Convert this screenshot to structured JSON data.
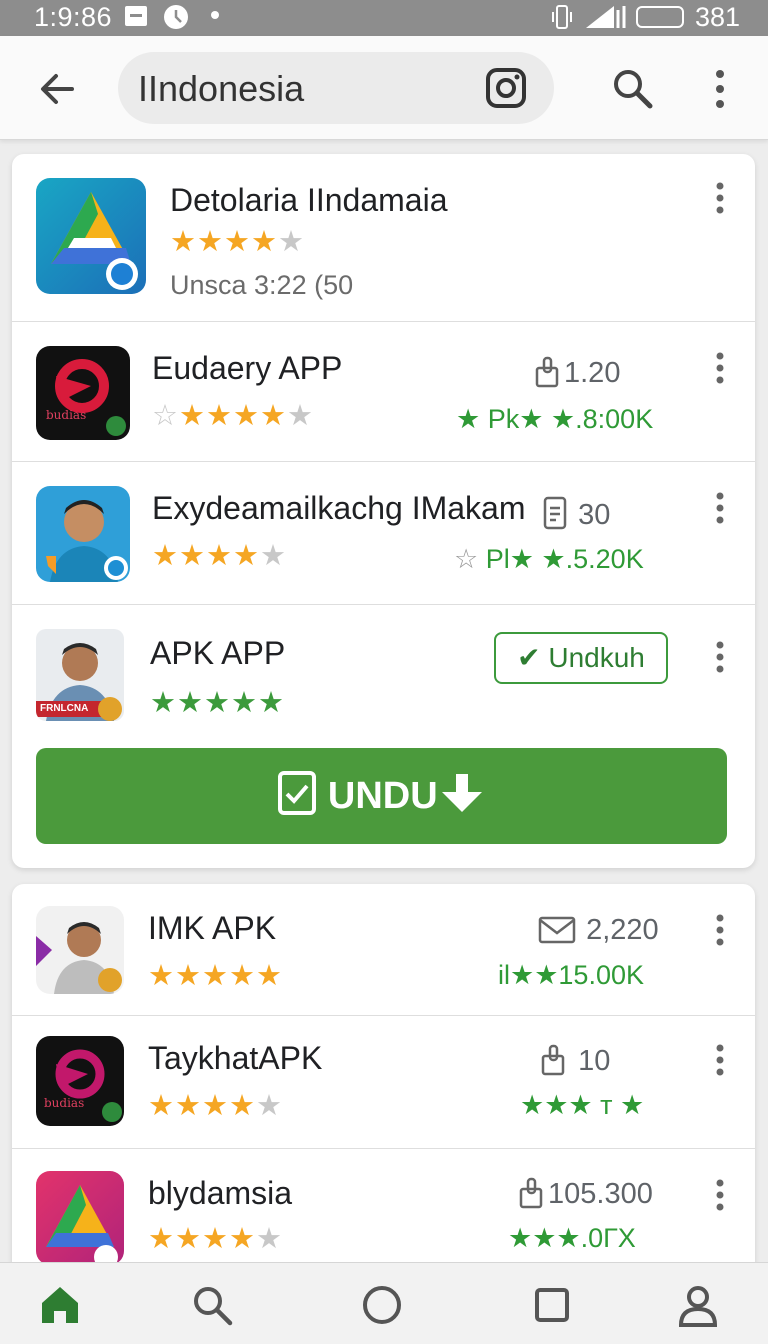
{
  "status_bar": {
    "time": "1:9:86",
    "battery": "381"
  },
  "search": {
    "query": "IIndonesia"
  },
  "featured": {
    "name": "Detolaria IIndamaia",
    "rating": 4.5,
    "meta": "Unsca 3:22 (50"
  },
  "apps": [
    {
      "name": "Eudaery APP",
      "stat": "1.20",
      "downloads": "Pk★ ★.8:00K",
      "rating": 4.5,
      "icon_label": "budias"
    },
    {
      "name": "Exydeamailkachg IMakam",
      "stat": "30",
      "downloads": "Pl★ ★.5.20K",
      "rating": 4.5
    },
    {
      "name": "APK APP",
      "install_label": "Undkuh",
      "rating": 4.5,
      "icon_label": "FRNLCNA"
    },
    {
      "name": "IMK APK",
      "stat": "2,220",
      "downloads": "il★★15.00K",
      "rating": 4.5
    },
    {
      "name": "TaykhatAPK",
      "stat": "10",
      "downloads": "★★★ ᴛ ★",
      "rating": 4,
      "icon_label": "budias"
    },
    {
      "name": "blydamsia",
      "stat": "105.300",
      "downloads": "★★★.0ГX",
      "rating": 4.5
    }
  ],
  "primary_button": {
    "label": "UNDU"
  },
  "colors": {
    "accent_green": "#4b9a3c",
    "star_orange": "#f5a623",
    "status_bar": "#8d8d8d"
  },
  "nav": {
    "items": [
      "home-icon",
      "search-icon",
      "circle-icon",
      "square-icon",
      "profile-icon"
    ]
  }
}
